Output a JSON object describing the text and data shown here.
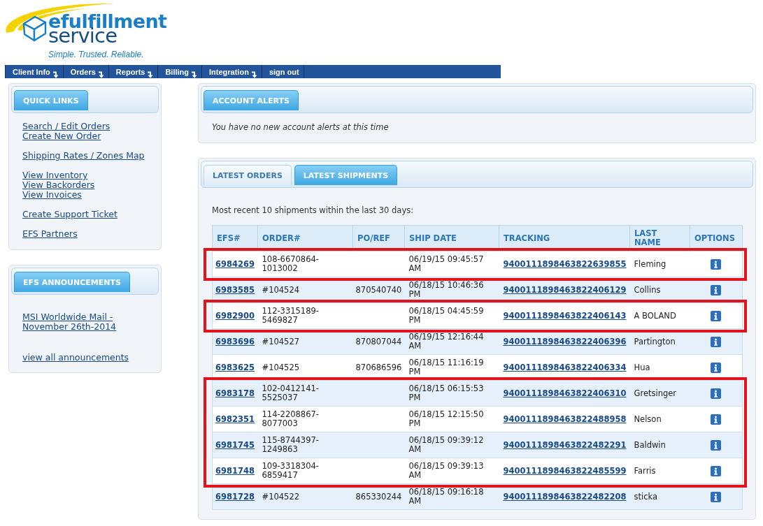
{
  "logo": {
    "name_line1": "efulfillment",
    "name_line2": "service",
    "tagline": "Simple. Trusted. Reliable."
  },
  "nav": [
    {
      "label": "Client Info",
      "has_menu": true
    },
    {
      "label": "Orders",
      "has_menu": true
    },
    {
      "label": "Reports",
      "has_menu": true
    },
    {
      "label": "Billing",
      "has_menu": true
    },
    {
      "label": "Integration",
      "has_menu": true
    },
    {
      "label": "sign out",
      "has_menu": false
    }
  ],
  "quick_links": {
    "title": "QUICK LINKS",
    "groups": [
      [
        "Search / Edit Orders",
        "Create New Order"
      ],
      [
        "Shipping Rates / Zones Map"
      ],
      [
        "View Inventory",
        "View Backorders",
        "View Invoices"
      ],
      [
        "Create Support Ticket"
      ],
      [
        "EFS Partners"
      ]
    ]
  },
  "announcements": {
    "title": "EFS ANNOUNCEMENTS",
    "items": [
      "MSI Worldwide Mail - November 26th-2014"
    ],
    "view_all": "view all announcements"
  },
  "account_alerts": {
    "title": "ACCOUNT ALERTS",
    "message": "You have no new account alerts at this time"
  },
  "latest": {
    "tabs": [
      {
        "label": "LATEST ORDERS",
        "selected": false
      },
      {
        "label": "LATEST SHIPMENTS",
        "selected": true
      }
    ],
    "caption": "Most recent 10 shipments within the last 30 days:",
    "table": {
      "columns": [
        "EFS#",
        "ORDER#",
        "PO/REF",
        "SHIP DATE",
        "TRACKING",
        "LAST NAME",
        "OPTIONS"
      ],
      "rows": [
        {
          "efs": "6984269",
          "order": "108-6670864-1013002",
          "ship_date": "06/19/15 09:45:57 AM",
          "tracking": "9400111898463822639855",
          "last_name": "Fleming",
          "marked": true
        },
        {
          "efs": "6983585",
          "order": "#104524",
          "po_ref": "870540740",
          "ship_date": "06/18/15 10:46:36 PM",
          "tracking": "9400111898463822406129",
          "last_name": "Collins",
          "marked": false
        },
        {
          "efs": "6982900",
          "order": "112-3315189-5469827",
          "ship_date": "06/18/15 04:45:59 PM",
          "tracking": "9400111898463822406143",
          "last_name": "A BOLAND",
          "marked": true
        },
        {
          "efs": "6983696",
          "order": "#104527",
          "po_ref": "870807044",
          "ship_date": "06/19/15 12:16:44 AM",
          "tracking": "9400111898463822406396",
          "last_name": "Partington",
          "marked": false
        },
        {
          "efs": "6983625",
          "order": "#104525",
          "po_ref": "870686596",
          "ship_date": "06/18/15 11:16:19 PM",
          "tracking": "9400111898463822406334",
          "last_name": "Hua",
          "marked": false
        },
        {
          "efs": "6983178",
          "order": "102-0412141-5525037",
          "ship_date": "06/18/15 06:15:53 PM",
          "tracking": "9400111898463822406310",
          "last_name": "Gretsinger",
          "marked": true
        },
        {
          "efs": "6982351",
          "order": "114-2208867-8077003",
          "ship_date": "06/18/15 12:15:50 PM",
          "tracking": "9400111898463822488958",
          "last_name": "Nelson",
          "marked": true
        },
        {
          "efs": "6981745",
          "order": "115-8744397-1249863",
          "ship_date": "06/18/15 09:39:12 AM",
          "tracking": "9400111898463822482291",
          "last_name": "Baldwin",
          "marked": true
        },
        {
          "efs": "6981748",
          "order": "109-3318304-6859417",
          "ship_date": "06/18/15 09:39:13 AM",
          "tracking": "9400111898463822485599",
          "last_name": "Farris",
          "marked": true
        },
        {
          "efs": "6981728",
          "order": "#104522",
          "po_ref": "865330244",
          "ship_date": "06/18/15 09:16:18 AM",
          "tracking": "9400111898463822482208",
          "last_name": "sticka",
          "marked": false
        }
      ]
    }
  }
}
